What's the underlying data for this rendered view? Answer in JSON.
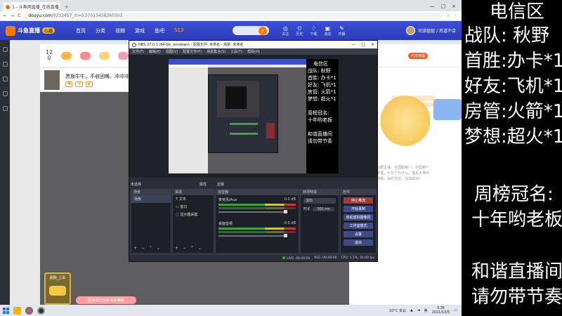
{
  "browser": {
    "tab_title": "1 - 斗鱼网直播_在线直播_斗...",
    "tab_close": "×",
    "tab_new": "+",
    "win_min": "—",
    "win_max": "□",
    "win_close": "×",
    "url_host": "douyu.com",
    "url_path": "/9212457_rr=0.57015458265503",
    "nav_back": "←",
    "nav_fwd": "→",
    "reload": "C",
    "star": "☆",
    "menu": "⋮"
  },
  "site": {
    "logo_text": "斗鱼直播",
    "logo_badge": "心选",
    "nav": [
      "首页",
      "分类",
      "视频",
      "游戏",
      "鱼吧",
      "S13"
    ],
    "header_icons": [
      {
        "glyph": "◎",
        "label": "关注"
      },
      {
        "glyph": "⏲",
        "label": "历史"
      },
      {
        "glyph": "♢",
        "label": "下载"
      },
      {
        "glyph": "▣",
        "label": "消息"
      },
      {
        "glyph": "✎",
        "label": "开播"
      }
    ],
    "user_name": "司游狙狙 / 耳道不合",
    "room_number": "12",
    "room_label": "0",
    "anchor_greeting": "贵族牛牛，不收回嘴，冲冲冲!",
    "chat_badge": "POE专属",
    "chat_text": "秋野主播，全国服第一，中国第一雷霆，十万个为什么，猎杀大神的偶像，灿烂天空，加油加油!",
    "gift_label": "超跑_上车",
    "barrage_btn": "此房间已开启·关闭弹幕"
  },
  "obs": {
    "title": "OBS 27.0.1 (64-bit, windows) - 配置文件: 未命名 - 场景: 未命名",
    "menu": [
      "文件(F)",
      "编辑(E)",
      "视图(V)",
      "配置文件(P)",
      "场景集合(S)",
      "工具(T)",
      "帮助(H)"
    ],
    "preview_overlay": [
      "电信区",
      "战队: 秋野",
      "首胜: 办卡*1",
      "好友: 飞机*1",
      "房管: 火箭*1",
      "梦想: 超火*1",
      "",
      "周榜冠名:",
      "十年哟老板",
      "",
      "和谐直播间",
      "请勿带节奏"
    ],
    "scene_header": "未选择",
    "props_btn": "属性",
    "filters_btn": "滤镜",
    "docks": {
      "scenes_title": "场景",
      "scenes": [
        "场景"
      ],
      "sources_title": "来源",
      "sources": [
        "文本",
        "窗口",
        "显示器采集"
      ],
      "mixer_title": "混音器",
      "mixer": [
        {
          "name": "麦克风/Aux",
          "value": "0.0 dB"
        },
        {
          "name": "桌面音频",
          "value": "-0.0 dB"
        }
      ],
      "trans_title": "转场特效",
      "trans_select": "淡出",
      "trans_duration_label": "时长",
      "trans_duration": "300 ms",
      "ctrl_title": "控件",
      "controls": [
        "停止推流",
        "开始录制",
        "启动虚拟摄像机",
        "工作室模式",
        "设置",
        "退出"
      ],
      "footer": "+ − ⌃ ⌄"
    },
    "status": {
      "live": "LIVE: 00:00:00",
      "rec": "REC: 00:00:00",
      "cpu": "CPU: 1.1%, 30.00 fps"
    }
  },
  "taskbar": {
    "weather": "10°C 多云",
    "time": "3:35",
    "date": "2021/10/5",
    "ime": "英"
  },
  "overlay": {
    "lines": [
      "电信区",
      "战队:  秋野",
      "首胜:办卡*1",
      "好友:飞机*1",
      "房管:火箭*1",
      "梦想:超火*1",
      "周榜冠名:",
      "十年哟老板",
      "和谐直播间",
      "请勿带节奏"
    ]
  },
  "colors": {
    "site_header": "#3b4fd4",
    "accent_orange": "#ff7a00",
    "obs_bg": "#2b2e38",
    "obs_button": "#3c4b8d",
    "overlay_bg": "#000000",
    "overlay_text": "#ffffff"
  }
}
